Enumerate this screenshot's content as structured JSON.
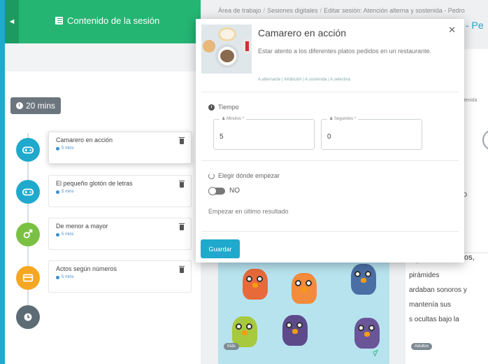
{
  "sidebar": {
    "back_icon": "arrow-left-icon",
    "title": "Contenido de la sesión",
    "title_icon": "list-icon",
    "duration": "20 mins",
    "activities": [
      {
        "title": "Camarero en acción",
        "duration": "5 mins",
        "icon": "gamepad-icon",
        "color": "#1fa9cc"
      },
      {
        "title": "El pequeño glotón de letras",
        "duration": "5 mins",
        "icon": "gamepad-icon",
        "color": "#1fa9cc"
      },
      {
        "title": "De menor a mayor",
        "duration": "5 mins",
        "icon": "gender-icon",
        "color": "#7ac143"
      },
      {
        "title": "Actos según números",
        "duration": "5 mins",
        "icon": "card-icon",
        "color": "#f5a623"
      }
    ],
    "end_icon": "clock-icon"
  },
  "breadcrumb": [
    "Área de trabajo",
    "Sesiones digitales",
    "Editar sesión: Atención alterna y sostenida - Pedro"
  ],
  "background": {
    "title_peek": "- Pe",
    "small_peek": "stenida",
    "o_peek": "o",
    "text_lines": [
      "os,",
      "pirámides",
      "ardaban sonoros y",
      "mantenía sus",
      "s ocultas bajo la"
    ],
    "tags": [
      "Kids",
      "Adultos"
    ]
  },
  "modal": {
    "title": "Camarero en acción",
    "description": "Estar atento a los diferentes platos pedidos en un restaurante.",
    "tags": "A.alternante | Inhibición | A.sostenida | A.selectiva",
    "close_icon": "close-icon",
    "time_section": "Tiempo",
    "minutes_label": "Minutos *",
    "minutes_value": "5",
    "seconds_label": "Segundos *",
    "seconds_value": "0",
    "start_section": "Elegir dónde empezar",
    "toggle_value": "NO",
    "resume_text": "Empezar en último resultado",
    "save_label": "Guardar"
  },
  "colors": {
    "sidebar_header": "#24b573",
    "accent": "#1fa9cc",
    "badge": "#6c757d"
  }
}
